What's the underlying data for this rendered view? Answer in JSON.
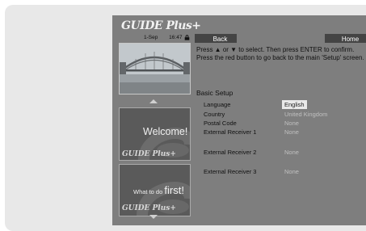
{
  "header": {
    "logo": "GUIDE Plus+",
    "date": "1-Sep",
    "time": "16:47"
  },
  "nav": {
    "back_label": "Back",
    "home_label": "Home"
  },
  "instructions": "Press ▲ or ▼ to select.  Then press ENTER to confirm. Press the red button to go back to the main 'Setup' screen.",
  "section_title": "Basic Setup",
  "settings": [
    {
      "label": "Language",
      "value": "English"
    },
    {
      "label": "Country",
      "value": "United Kingdom"
    },
    {
      "label": "Postal Code",
      "value": "None"
    },
    {
      "label": "External Receiver 1",
      "value": "None"
    },
    {
      "label": "External Receiver 2",
      "value": "None"
    },
    {
      "label": "External Receiver 3",
      "value": "None"
    }
  ],
  "panels": {
    "welcome": "Welcome!",
    "what_to_do": "What to do",
    "first": "first!"
  },
  "icons": {
    "lock": "lock-icon",
    "up_arrow": "up-arrow-icon",
    "down_arrow": "down-arrow-icon"
  },
  "colors": {
    "screen_bg": "#7e7e7e",
    "button_bg": "#444444",
    "value_text": "#c0c0c0",
    "selected_value_bg": "#e9e9e9"
  }
}
